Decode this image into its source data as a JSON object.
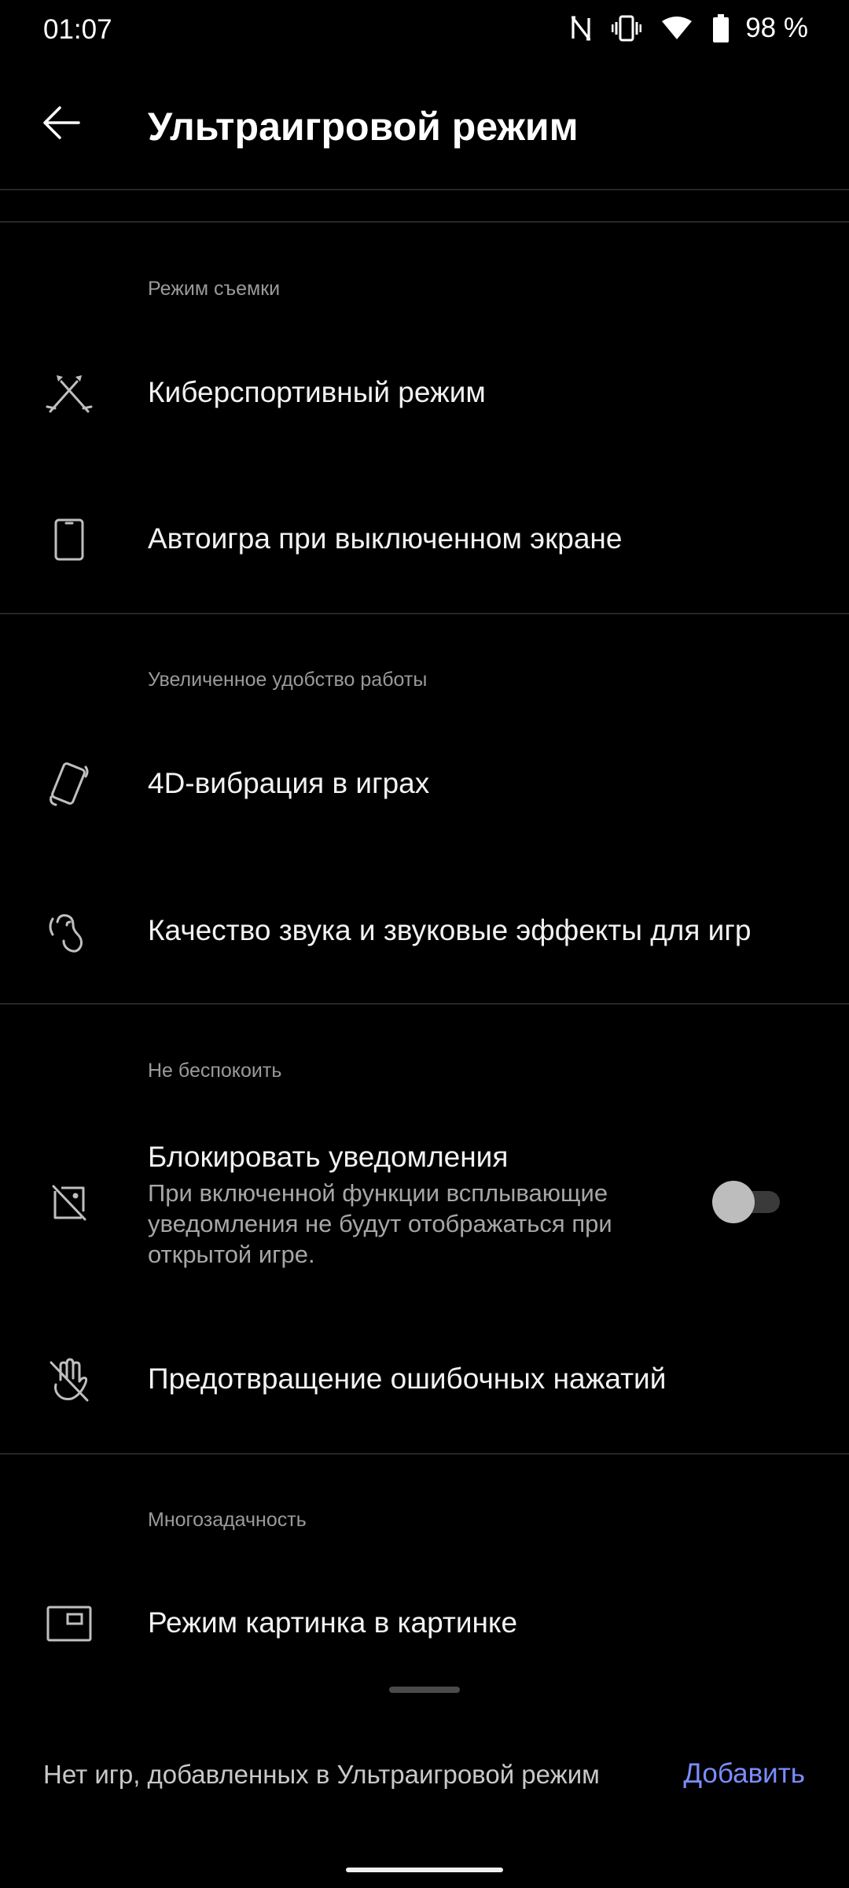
{
  "status_bar": {
    "time": "01:07",
    "battery": "98 %",
    "icons": [
      "nfc-icon",
      "vibrate-icon",
      "wifi-icon",
      "battery-icon"
    ]
  },
  "header": {
    "title": "Ультраигровой режим",
    "back_icon": "arrow-left-icon"
  },
  "sections": {
    "shooting": {
      "header": "Режим съемки",
      "esports": "Киберспортивный режим",
      "auto_play": "Автоигра при выключенном экране"
    },
    "comfort": {
      "header": "Увеличенное удобство работы",
      "vibration": "4D-вибрация в играх",
      "sound": "Качество звука и звуковые эффекты для игр"
    },
    "dnd": {
      "header": "Не беспокоить",
      "block_title": "Блокировать уведомления",
      "block_summary": "При включенной функции всплывающие уведомления не будут отображаться при открытой игре.",
      "block_enabled": false,
      "mistouch": "Предотвращение ошибочных нажатий"
    },
    "multitask": {
      "header": "Многозадачность",
      "pip": "Режим картинка в картинке"
    }
  },
  "bottom_sheet": {
    "message": "Нет игр, добавленных в Ультраигровой режим",
    "add_label": "Добавить"
  },
  "colors": {
    "background": "#000000",
    "accent": "#7b8dff",
    "divider": "#262626",
    "secondary_text": "#9a9a9a"
  }
}
